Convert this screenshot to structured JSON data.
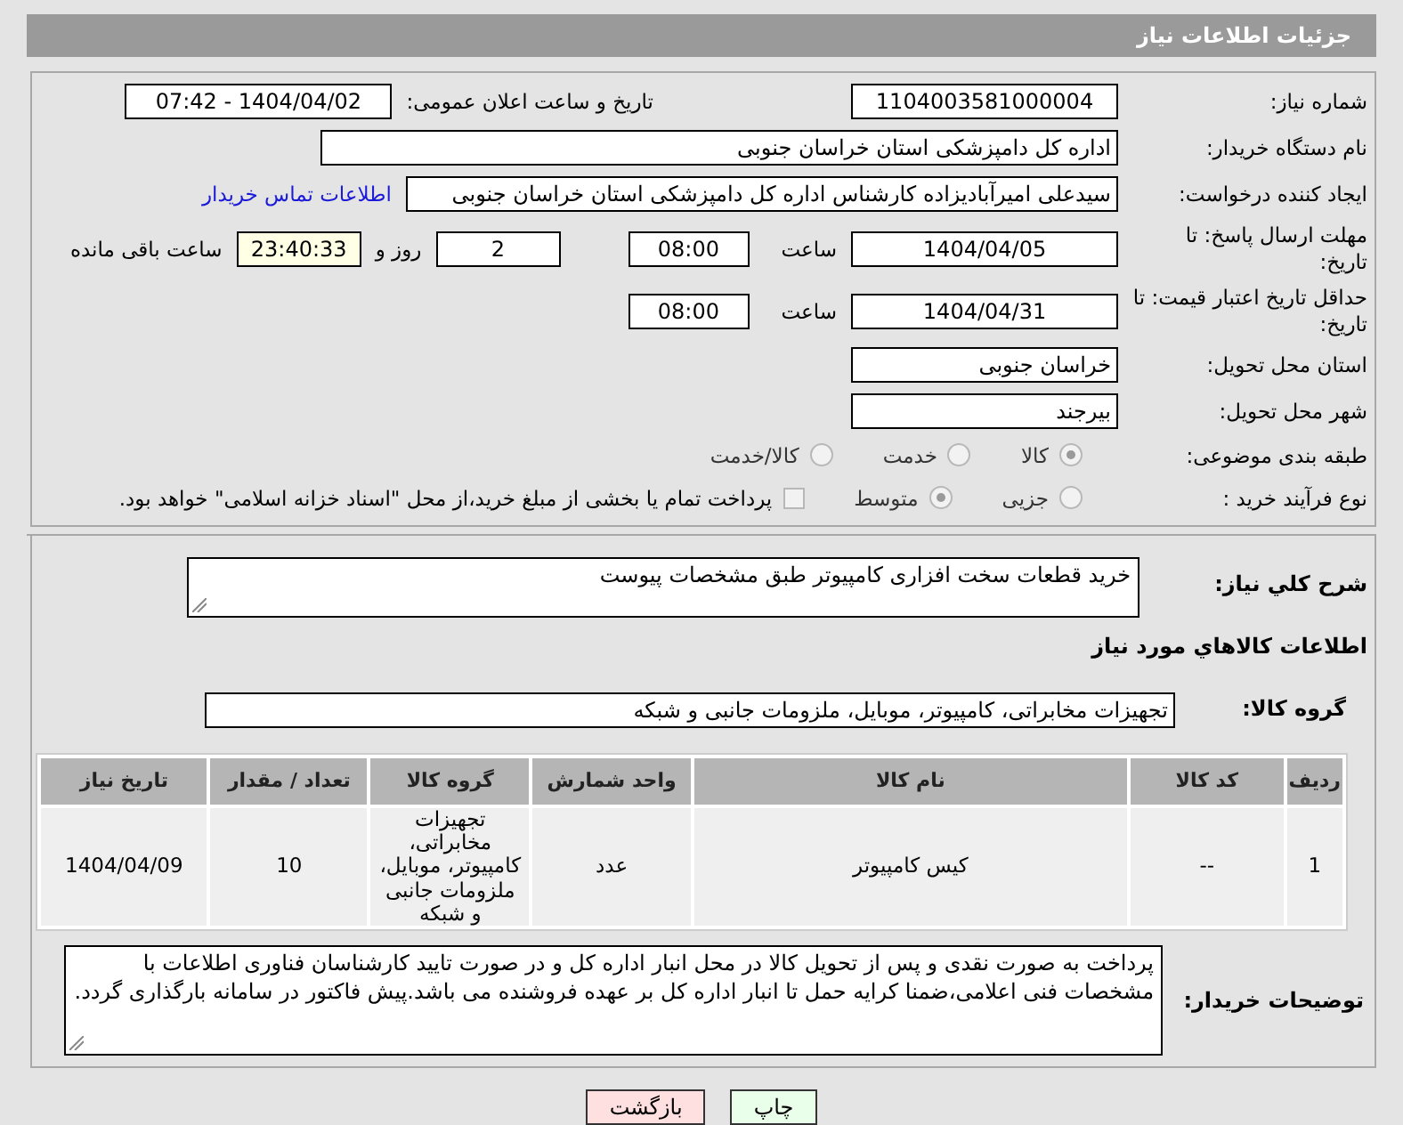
{
  "header": {
    "title": "جزئیات اطلاعات نیاز"
  },
  "need_number": {
    "label": "شماره نیاز:",
    "value": "1104003581000004"
  },
  "announce": {
    "label": "تاریخ و ساعت اعلان عمومی:",
    "value": "1404/04/02 - 07:42"
  },
  "buyer": {
    "label": "نام دستگاه خریدار:",
    "value": "اداره کل دامپزشکی استان خراسان جنوبی"
  },
  "creator": {
    "label": "ایجاد کننده درخواست:",
    "value": "سیدعلی امیرآبادیزاده کارشناس اداره کل دامپزشکی استان خراسان جنوبی",
    "link": "اطلاعات تماس خریدار"
  },
  "deadline": {
    "label": "مهلت ارسال پاسخ: تا تاریخ:",
    "date": "1404/04/05",
    "time_label": "ساعت",
    "time": "08:00",
    "days": "2",
    "days_label": "روز و",
    "remaining": "23:40:33",
    "remaining_label": "ساعت باقی مانده"
  },
  "validity": {
    "label": "حداقل تاریخ اعتبار قیمت: تا تاریخ:",
    "date": "1404/04/31",
    "time_label": "ساعت",
    "time": "08:00"
  },
  "province": {
    "label": "استان محل تحویل:",
    "value": "خراسان جنوبی"
  },
  "city": {
    "label": "شهر محل تحویل:",
    "value": "بیرجند"
  },
  "category": {
    "label": "طبقه بندی موضوعی:",
    "options": [
      {
        "label": "کالا",
        "selected": true
      },
      {
        "label": "خدمت",
        "selected": false
      },
      {
        "label": "کالا/خدمت",
        "selected": false
      }
    ]
  },
  "process": {
    "label": "نوع فرآیند خرید :",
    "options": [
      {
        "label": "جزیی",
        "selected": false
      },
      {
        "label": "متوسط",
        "selected": true
      }
    ],
    "payment": {
      "checked": false,
      "text": "پرداخت تمام یا بخشی از مبلغ خرید،از محل \"اسناد خزانه اسلامی\" خواهد بود."
    }
  },
  "description": {
    "label": "شرح كلي نياز:",
    "value": "خرید قطعات سخت افزاری کامپیوتر طبق مشخصات پیوست"
  },
  "goods_title": "اطلاعات كالاهاي مورد نياز",
  "goods_group": {
    "label": "گروه کالا:",
    "value": "تجهیزات مخابراتی، کامپیوتر، موبایل، ملزومات جانبی و شبکه"
  },
  "table": {
    "columns": [
      "ردیف",
      "کد کالا",
      "نام کالا",
      "واحد شمارش",
      "گروه کالا",
      "تعداد / مقدار",
      "تاریخ نیاز"
    ],
    "rows": [
      [
        "1",
        "--",
        "کیس کامپیوتر",
        "عدد",
        "تجهیزات مخابراتی، کامپیوتر، موبایل، ملزومات جانبی و شبکه",
        "10",
        "1404/04/09"
      ]
    ]
  },
  "buyer_notes": {
    "label": "توضیحات خریدار:",
    "value": "پرداخت به صورت نقدی و پس از تحویل کالا در محل انبار اداره کل و در صورت تایید کارشناسان فناوری اطلاعات با مشخصات فنی اعلامی،ضمنا کرایه حمل تا انبار اداره کل بر عهده فروشنده می باشد.پیش فاکتور در سامانه بارگذاری گردد."
  },
  "buttons": [
    {
      "label": "چاپ",
      "kind": "print"
    },
    {
      "label": "بازگشت",
      "kind": "back"
    }
  ]
}
